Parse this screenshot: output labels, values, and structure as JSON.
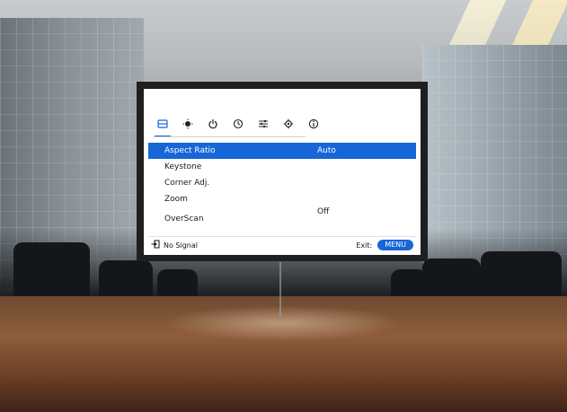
{
  "osd": {
    "tabs": [
      {
        "icon": "aspect-ratio-icon",
        "active": true
      },
      {
        "icon": "brightness-icon",
        "active": false
      },
      {
        "icon": "power-icon",
        "active": false
      },
      {
        "icon": "clock-icon",
        "active": false
      },
      {
        "icon": "sliders-icon",
        "active": false
      },
      {
        "icon": "gear-icon",
        "active": false
      },
      {
        "icon": "info-icon",
        "active": false
      }
    ],
    "items": [
      {
        "label": "Aspect Ratio",
        "value": "Auto"
      },
      {
        "label": "Keystone",
        "value": ""
      },
      {
        "label": "Corner Adj.",
        "value": ""
      },
      {
        "label": "Zoom",
        "value": ""
      },
      {
        "label": "OverScan",
        "value": "Off"
      }
    ],
    "footer": {
      "signal_text": "No Signal",
      "exit_label": "Exit:",
      "menu_label": "MENU"
    }
  },
  "colors": {
    "accent": "#1666d8",
    "background": "#ffffff",
    "text": "#1a1a1a"
  }
}
